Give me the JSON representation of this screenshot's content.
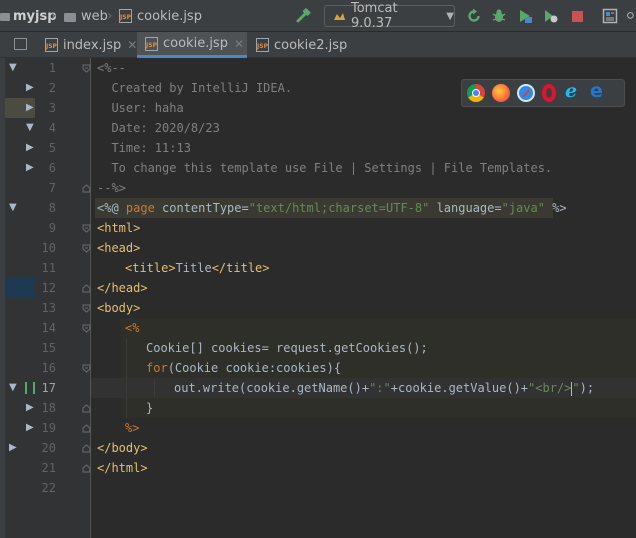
{
  "breadcrumb": {
    "project": "myjsp",
    "folder": "web",
    "file": "cookie.jsp"
  },
  "toolbar": {
    "run_config": "Tomcat 9.0.37",
    "icons": [
      "build-icon",
      "tomcat-icon",
      "rerun-icon",
      "debug-icon",
      "coverage-icon",
      "profile-icon",
      "stop-icon",
      "project-structure-icon",
      "search-icon"
    ]
  },
  "tabs": [
    {
      "label": "index.jsp",
      "active": false,
      "closable": true
    },
    {
      "label": "cookie.jsp",
      "active": true,
      "closable": true
    },
    {
      "label": "cookie2.jsp",
      "active": false,
      "closable": false
    }
  ],
  "editor": {
    "current_line": 17,
    "line_numbers": [
      "1",
      "2",
      "3",
      "4",
      "5",
      "6",
      "7",
      "8",
      "9",
      "10",
      "11",
      "12",
      "13",
      "14",
      "15",
      "16",
      "17",
      "18",
      "19",
      "20",
      "21",
      "22"
    ],
    "code": {
      "l1": "<%--",
      "l2": "  Created by IntelliJ IDEA.",
      "l3": "  User: haha",
      "l4": "  Date: 2020/8/23",
      "l5": "  Time: 11:13",
      "l6": "  To change this template use File | Settings | File Templates.",
      "l7": "--%>",
      "l8_a": "<%@ ",
      "l8_b": "page ",
      "l8_c": "contentType=",
      "l8_d": "\"text/html;charset=UTF-8\"",
      "l8_e": " language=",
      "l8_f": "\"java\"",
      "l8_g": " %>",
      "l9": "<html>",
      "l10": "<head>",
      "l11_a": "<title>",
      "l11_b": "Title",
      "l11_c": "</title>",
      "l12": "</head>",
      "l13": "<body>",
      "l14": "<%",
      "l15": "Cookie[] cookies= request.getCookies();",
      "l16_a": "for",
      "l16_b": "(Cookie cookie:cookies){",
      "l17_a": "out.write(cookie.getName()+",
      "l17_b": "\":\"",
      "l17_c": "+cookie.getValue()+",
      "l17_d": "\"<br/>",
      "l17_e": "\"",
      "l17_f": ");",
      "l18": "}",
      "l19": "%>",
      "l20": "</body>",
      "l21": "</html>"
    }
  },
  "browsers": [
    "chrome-icon",
    "firefox-icon",
    "safari-icon",
    "opera-icon",
    "ie-icon",
    "edge-icon"
  ],
  "colors": {
    "background": "#2B2B2B",
    "gutter": "#313335",
    "comment": "#808080",
    "tag": "#E8BF6A",
    "string": "#6A8759",
    "keyword": "#CC7832",
    "text": "#A9B7C6",
    "accent": "#4A88C7"
  }
}
